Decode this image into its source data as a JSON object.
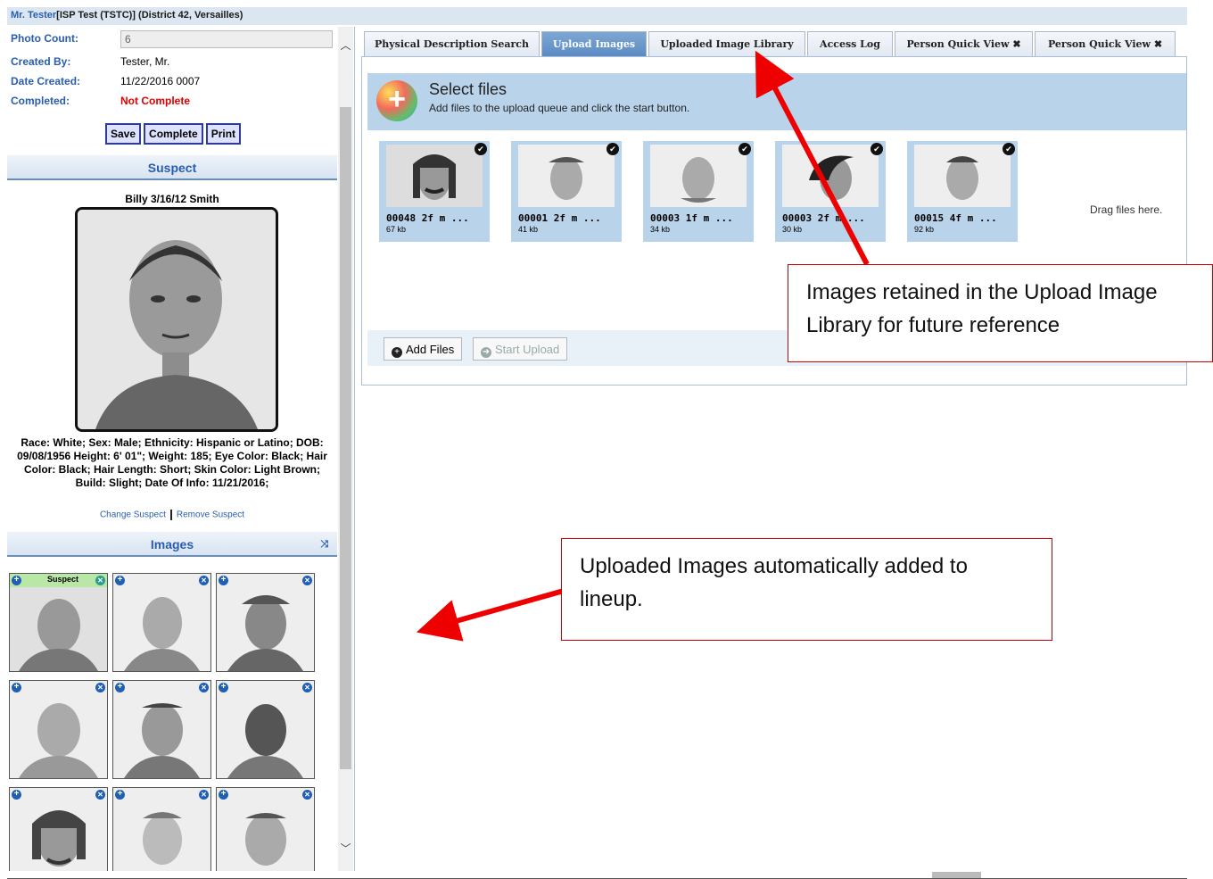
{
  "header": {
    "user_link": "Mr. Tester",
    "context": "[ISP Test (TSTC)] (District 42, Versailles)"
  },
  "info": {
    "photo_count_label": "Photo Count:",
    "photo_count_value": "6",
    "created_by_label": "Created By:",
    "created_by_value": "Tester, Mr.",
    "date_created_label": "Date Created:",
    "date_created_value": "11/22/2016 0007",
    "completed_label": "Completed:",
    "completed_value": "Not Complete"
  },
  "buttons": {
    "save": "Save",
    "complete": "Complete",
    "print": "Print"
  },
  "suspect": {
    "header": "Suspect",
    "name": "Billy 3/16/12 Smith",
    "description": "Race: White; Sex: Male; Ethnicity: Hispanic or Latino; DOB: 09/08/1956 Height: 6' 01\"; Weight: 185; Eye Color: Black; Hair Color: Black; Hair Length: Short; Skin Color: Light Brown; Build: Slight; Date Of Info: 11/21/2016;",
    "change_link": "Change Suspect",
    "remove_link": "Remove Suspect"
  },
  "images": {
    "header": "Images",
    "suspect_badge": "Suspect"
  },
  "tabs": [
    {
      "label": "Physical Description Search",
      "closable": false
    },
    {
      "label": "Upload Images",
      "closable": false,
      "active": true
    },
    {
      "label": "Uploaded Image Library",
      "closable": false
    },
    {
      "label": "Access Log",
      "closable": false
    },
    {
      "label": "Person Quick View",
      "closable": true
    },
    {
      "label": "Person Quick View",
      "closable": true
    }
  ],
  "uploader": {
    "title": "Select files",
    "subtitle": "Add files to the upload queue and click the start button.",
    "drag_text": "Drag files here.",
    "add_files": "Add Files",
    "start_upload": "Start Upload",
    "files": [
      {
        "name": "00048 2f m ...",
        "size": "67 kb"
      },
      {
        "name": "00001 2f m ...",
        "size": "41 kb"
      },
      {
        "name": "00003 1f m ...",
        "size": "34 kb"
      },
      {
        "name": "00003 2f m ...",
        "size": "30 kb"
      },
      {
        "name": "00015 4f m ...",
        "size": "92 kb"
      }
    ]
  },
  "callouts": {
    "library": "Images retained in the Upload Image Library for future reference",
    "lineup": "Uploaded Images automatically added to lineup."
  }
}
